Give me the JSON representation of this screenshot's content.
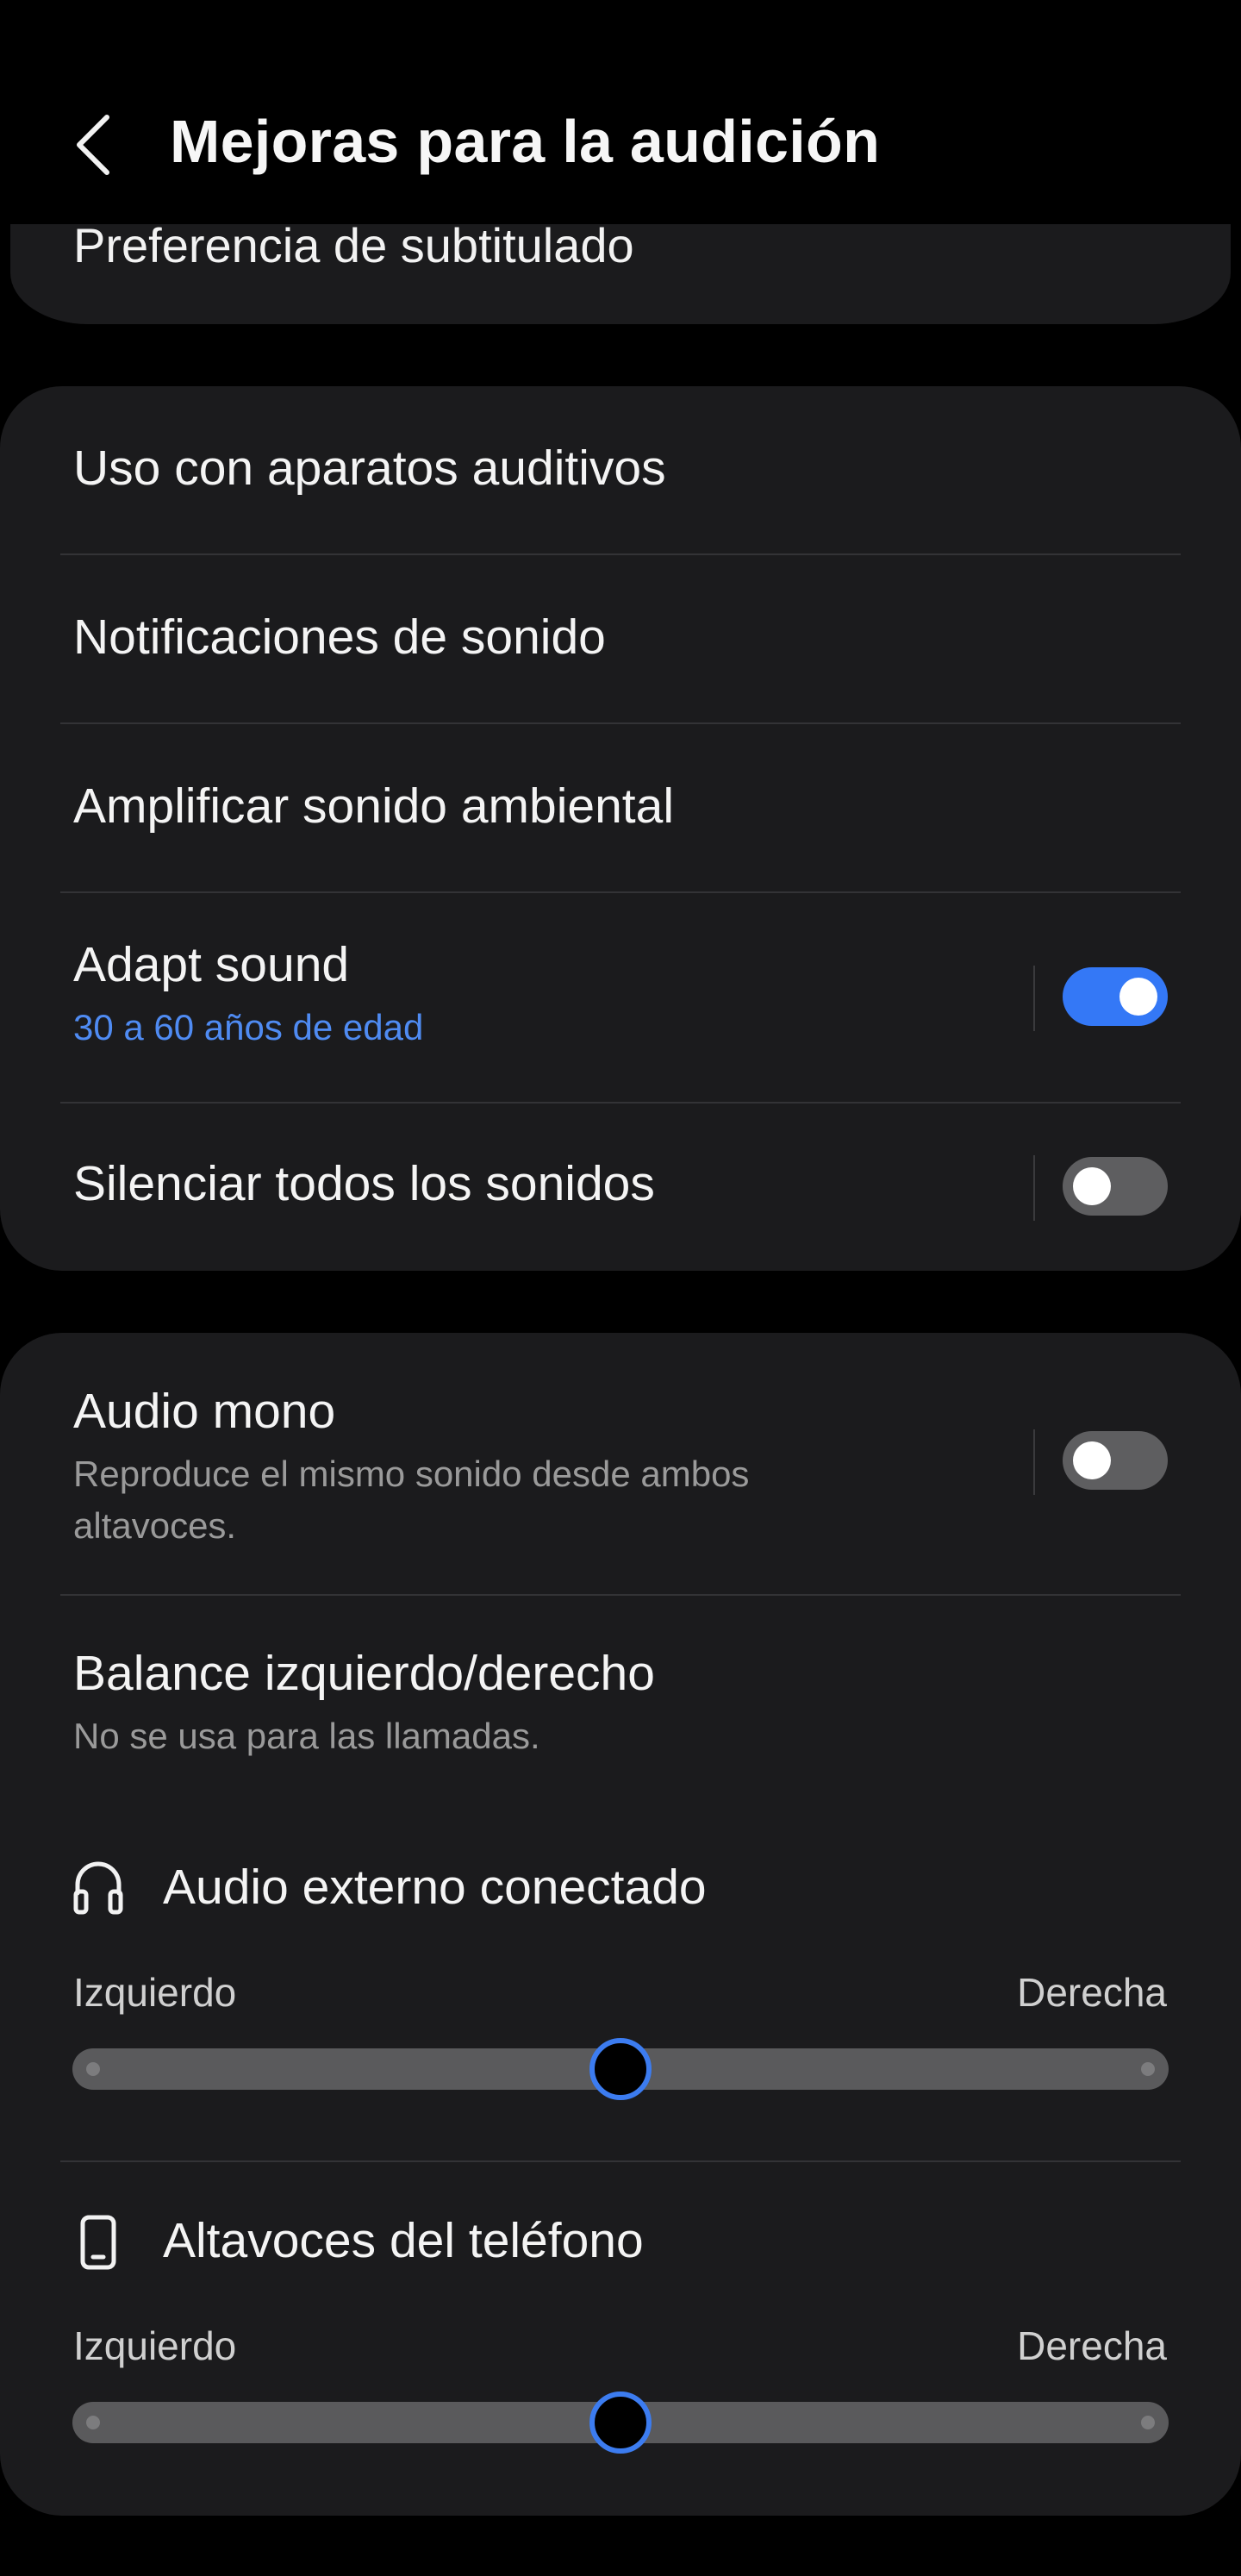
{
  "header": {
    "title": "Mejoras para la audición",
    "back_icon": "chevron-left-icon"
  },
  "peek_item": {
    "label": "Preferencia de subtitulado"
  },
  "group1": {
    "hearing_aids": "Uso con aparatos auditivos",
    "sound_notifications": "Notificaciones de sonido",
    "amplify_ambient": "Amplificar sonido ambiental",
    "adapt_sound": {
      "label": "Adapt sound",
      "sub": "30 a 60 años de edad",
      "enabled": true
    },
    "mute_all": {
      "label": "Silenciar todos los sonidos",
      "enabled": false
    }
  },
  "group2": {
    "mono_audio": {
      "label": "Audio mono",
      "sub": "Reproduce el mismo sonido desde ambos altavoces.",
      "enabled": false
    },
    "balance": {
      "label": "Balance izquierdo/derecho",
      "sub": "No se usa para las llamadas."
    },
    "external": {
      "icon": "headphones-icon",
      "label": "Audio externo conectado",
      "left_label": "Izquierdo",
      "right_label": "Derecha",
      "value": 0.5
    },
    "phone_speakers": {
      "icon": "phone-icon",
      "label": "Altavoces del teléfono",
      "left_label": "Izquierdo",
      "right_label": "Derecha",
      "value": 0.5
    }
  },
  "colors": {
    "accent": "#3478f6",
    "card": "#1b1b1d",
    "background": "#000000",
    "sub_blue": "#4f8bf2"
  }
}
